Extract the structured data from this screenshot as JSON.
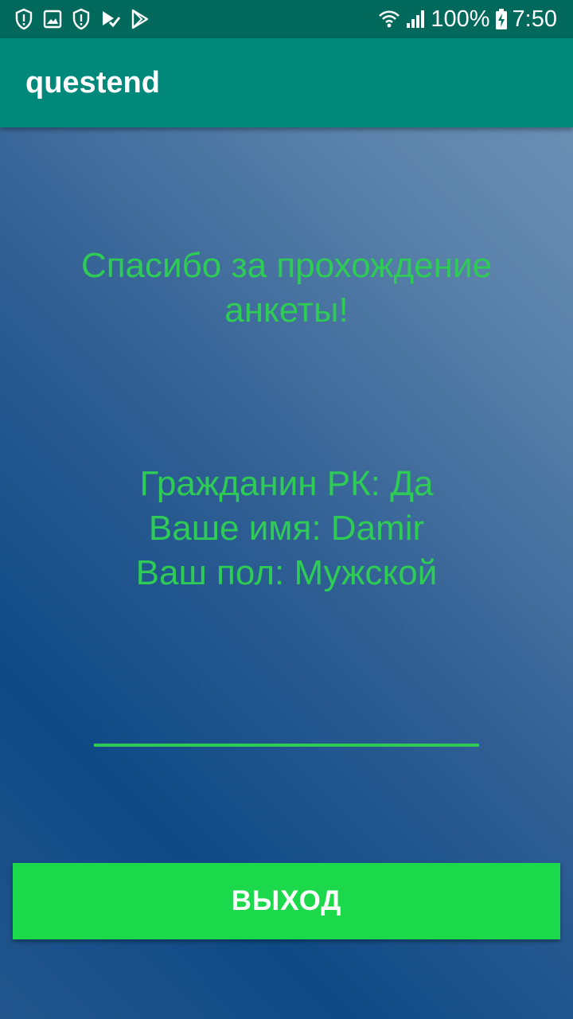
{
  "status_bar": {
    "battery_percent": "100%",
    "time": "7:50",
    "icons": [
      "shield-alert-icon",
      "image-icon",
      "shield-alert-icon",
      "play-check-icon",
      "play-store-icon",
      "wifi-icon",
      "cell-signal-icon",
      "battery-charging-icon"
    ]
  },
  "app_bar": {
    "title": "questend"
  },
  "content": {
    "thanks_message": "Спасибо за прохождение анкеты!",
    "citizen_line": "Гражданин РК: Да",
    "name_line": "Ваше имя: Damir",
    "gender_line": "Ваш пол: Мужской",
    "input_value": ""
  },
  "actions": {
    "exit_label": "ВЫХОД"
  },
  "colors": {
    "status_bar": "#00695c",
    "app_bar": "#00897b",
    "accent_text": "#2ecc55",
    "button": "#1bd94a",
    "background_dark": "#0f4a86",
    "background_light": "#7196b8"
  }
}
